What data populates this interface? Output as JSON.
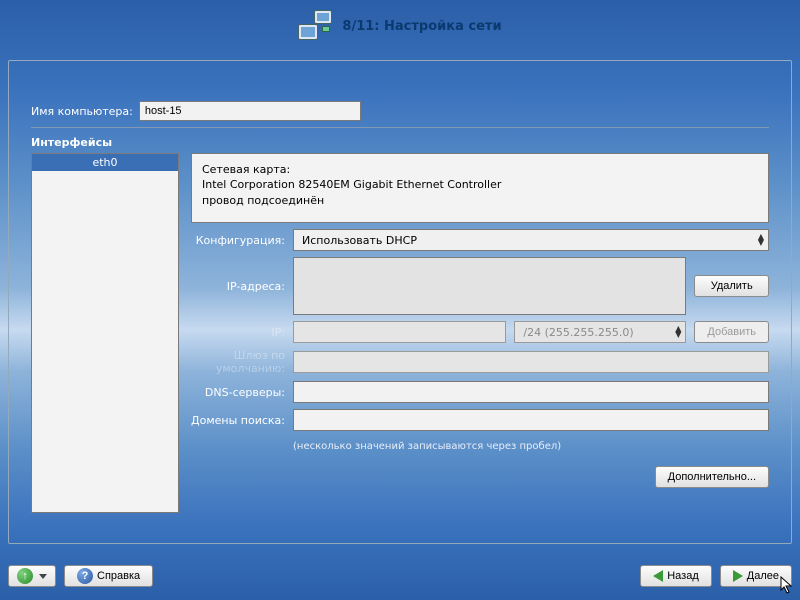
{
  "header": {
    "title": "8/11: Настройка сети"
  },
  "hostname": {
    "label": "Имя компьютера:",
    "value": "host-15"
  },
  "interfaces": {
    "title": "Интерфейсы",
    "items": [
      "eth0"
    ],
    "info": {
      "card_label": "Сетевая карта:",
      "card_model": "Intel Corporation 82540EM Gigabit Ethernet Controller",
      "cable": "провод подсоединён"
    }
  },
  "config": {
    "label": "Конфигурация:",
    "selected": "Использовать DHCP"
  },
  "ip": {
    "addresses_label": "IP-адреса:",
    "delete_btn": "Удалить",
    "ip_label": "IP:",
    "ip_value": "",
    "mask_placeholder": "/24 (255.255.255.0)",
    "add_btn": "Добавить"
  },
  "gateway": {
    "label": "Шлюз по умолчанию:",
    "value": ""
  },
  "dns": {
    "label": "DNS-серверы:",
    "value": ""
  },
  "search": {
    "label": "Домены поиска:",
    "value": ""
  },
  "note": "(несколько значений записываются через пробел)",
  "advanced_btn": "Дополнительно...",
  "footer": {
    "help": "Справка",
    "back": "Назад",
    "next": "Далее"
  }
}
